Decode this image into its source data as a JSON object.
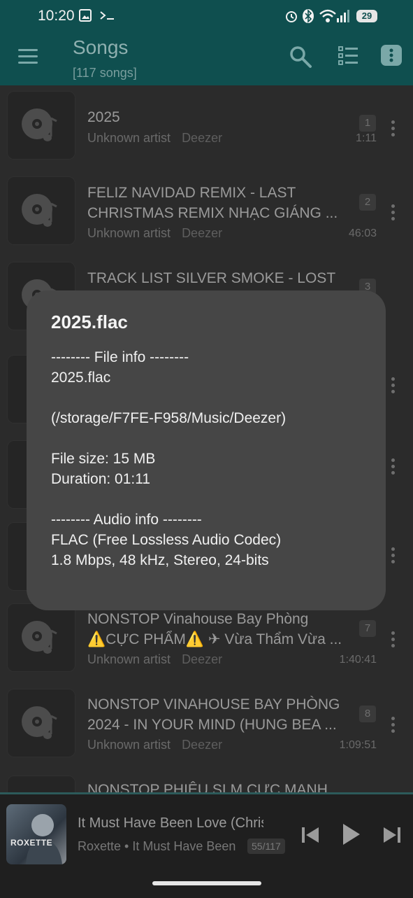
{
  "status": {
    "time": "10:20",
    "battery": "29",
    "icons": [
      "image-icon",
      "terminal-icon",
      "alarm-icon",
      "bluetooth-icon",
      "wifi-icon",
      "signal-icon",
      "battery-icon"
    ]
  },
  "appbar": {
    "title": "Songs",
    "subtitle": "[117 songs]",
    "icons": [
      "menu-icon",
      "search-icon",
      "list-view-icon",
      "overflow-icon"
    ]
  },
  "songs": [
    {
      "title": "2025",
      "artist": "Unknown artist",
      "source": "Deezer",
      "number": "1",
      "duration": "1:11"
    },
    {
      "title": "FELIZ NAVIDAD REMIX - LAST CHRISTMAS REMIX NHẠC GIÁNG ...",
      "artist": "Unknown artist",
      "source": "Deezer",
      "number": "2",
      "duration": "46:03"
    },
    {
      "title": "TRACK LIST SILVER SMOKE - LOST",
      "number": "3"
    },
    {
      "title": "NONSTOP Vinahouse Bay Phòng ⚠️CỰC PHẨM⚠️ ✈ Vừa Thẩm Vừa ...",
      "artist": "Unknown artist",
      "source": "Deezer",
      "number": "7",
      "duration": "1:40:41"
    },
    {
      "title": "NONSTOP VINAHOUSE BAY PHÒNG 2024 - IN YOUR MIND (HUNG BEA ...",
      "artist": "Unknown artist",
      "source": "Deezer",
      "number": "8",
      "duration": "1:09:51"
    },
    {
      "title": "NONSTOP PHIÊU SLM CỰC MẠNH"
    }
  ],
  "dialog": {
    "title": "2025.flac",
    "body": "-------- File info --------\n2025.flac\n\n(/storage/F7FE-F958/Music/Deezer)\n\nFile size: 15 MB\nDuration: 01:11\n\n-------- Audio info --------\nFLAC (Free Lossless Audio Codec)\n1.8 Mbps, 48 kHz, Stereo, 24-bits"
  },
  "now_playing": {
    "title": "It Must Have Been Love (Chris",
    "artist": "Roxette • It Must Have Been",
    "position": "55/117",
    "album_art_text": "ROXETTE",
    "controls": [
      "previous-icon",
      "play-icon",
      "next-icon"
    ]
  }
}
